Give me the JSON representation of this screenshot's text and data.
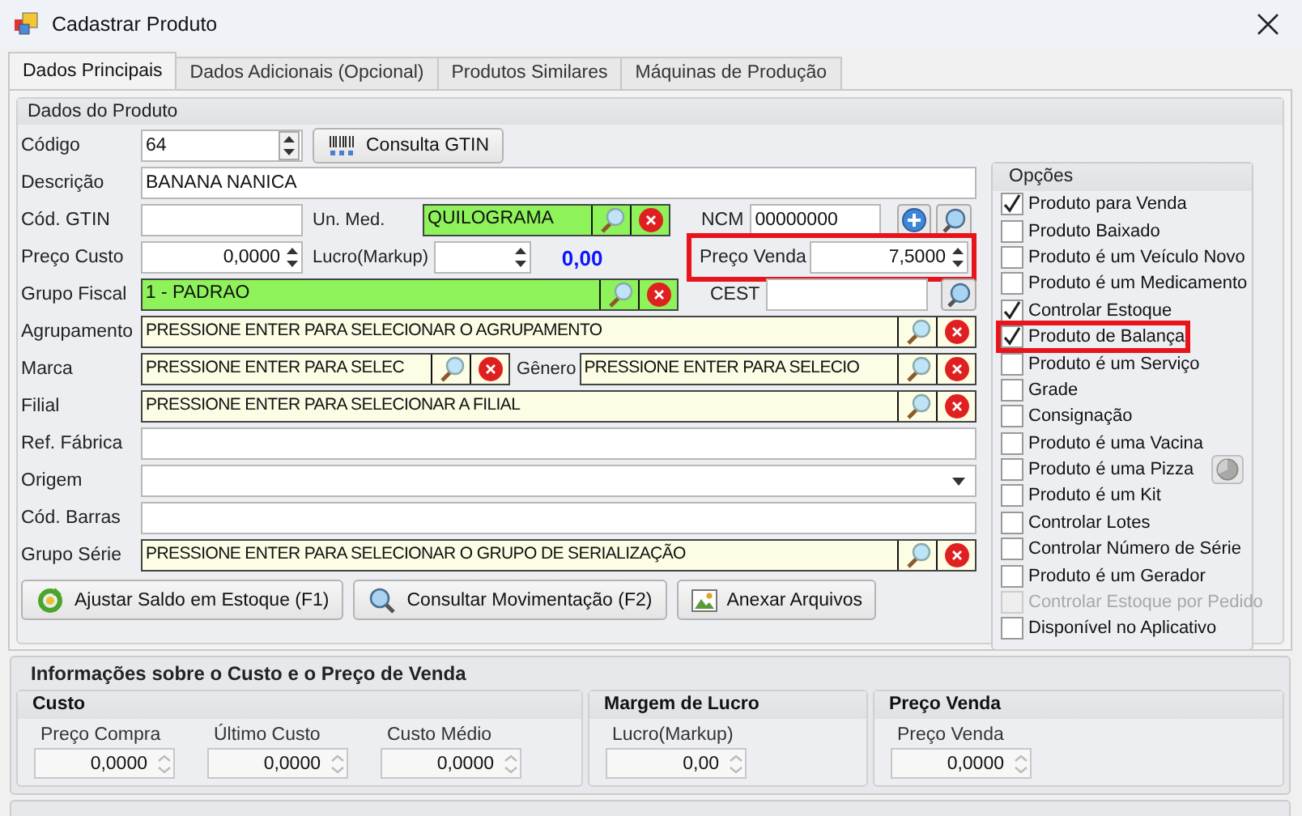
{
  "window": {
    "title": "Cadastrar Produto"
  },
  "tabs": [
    {
      "label": "Dados Principais",
      "selected": true
    },
    {
      "label": "Dados Adicionais (Opcional)",
      "selected": false
    },
    {
      "label": "Produtos Similares",
      "selected": false
    },
    {
      "label": "Máquinas de Produção",
      "selected": false
    }
  ],
  "product_group": {
    "title": "Dados do Produto",
    "rows": [
      {
        "kind": "code",
        "label": "Código",
        "value": "64",
        "button": "Consulta GTIN"
      },
      {
        "kind": "text",
        "label": "Descrição",
        "value": "BANANA NANICA"
      },
      {
        "kind": "gtin",
        "label": "Cód. GTIN",
        "unit_label": "Un. Med.",
        "unit_value": "QUILOGRAMA",
        "ncm_label": "NCM",
        "ncm_value": "00000000"
      },
      {
        "kind": "price",
        "label": "Preço Custo",
        "value": "0,0000",
        "markup_label": "Lucro(Markup)",
        "markup_result": "0,00",
        "sale_label": "Preço Venda",
        "sale_value": "7,5000",
        "sale_highlighted": true
      },
      {
        "kind": "fiscal",
        "label": "Grupo Fiscal",
        "value": "1 - PADRAO",
        "cest_label": "CEST"
      },
      {
        "kind": "lookup",
        "label": "Agrupamento",
        "value": "PRESSIONE ENTER PARA SELECIONAR O AGRUPAMENTO"
      },
      {
        "kind": "split",
        "label": "Marca",
        "value": "PRESSIONE ENTER PARA SELEC",
        "second_label": "Gênero",
        "second_value": "PRESSIONE ENTER PARA SELECIO"
      },
      {
        "kind": "lookup",
        "label": "Filial",
        "value": "PRESSIONE ENTER PARA SELECIONAR A FILIAL"
      },
      {
        "kind": "text",
        "label": "Ref. Fábrica"
      },
      {
        "kind": "combo",
        "label": "Origem"
      },
      {
        "kind": "text",
        "label": "Cód. Barras"
      },
      {
        "kind": "lookup",
        "label": "Grupo Série",
        "value": "PRESSIONE ENTER PARA SELECIONAR O GRUPO DE SERIALIZAÇÃO"
      }
    ],
    "buttons": [
      {
        "kind": "refresh",
        "label": "Ajustar Saldo em Estoque (F1)"
      },
      {
        "kind": "search",
        "label": "Consultar Movimentação (F2)"
      },
      {
        "kind": "image",
        "label": "Anexar Arquivos"
      }
    ]
  },
  "options": {
    "title": "Opções",
    "items": [
      {
        "label": "Produto para Venda",
        "checked": true,
        "disabled": false,
        "highlighted": false
      },
      {
        "label": "Produto Baixado",
        "checked": false,
        "disabled": false,
        "highlighted": false
      },
      {
        "label": "Produto é um Veículo Novo",
        "checked": false,
        "disabled": false,
        "highlighted": false
      },
      {
        "label": "Produto é um Medicamento",
        "checked": false,
        "disabled": false,
        "highlighted": false
      },
      {
        "label": "Controlar Estoque",
        "checked": true,
        "disabled": false,
        "highlighted": false
      },
      {
        "label": "Produto de Balança",
        "checked": true,
        "disabled": false,
        "highlighted": true
      },
      {
        "label": "Produto é um Serviço",
        "checked": false,
        "disabled": false,
        "highlighted": false
      },
      {
        "label": "Grade",
        "checked": false,
        "disabled": false,
        "highlighted": false
      },
      {
        "label": "Consignação",
        "checked": false,
        "disabled": false,
        "highlighted": false
      },
      {
        "label": "Produto é uma Vacina",
        "checked": false,
        "disabled": false,
        "highlighted": false
      },
      {
        "label": "Produto é uma Pizza",
        "checked": false,
        "disabled": false,
        "highlighted": false,
        "kind": "with_button"
      },
      {
        "label": "Produto é um Kit",
        "checked": false,
        "disabled": false,
        "highlighted": false
      },
      {
        "label": "Controlar Lotes",
        "checked": false,
        "disabled": false,
        "highlighted": false
      },
      {
        "label": "Controlar Número de Série",
        "checked": false,
        "disabled": false,
        "highlighted": false
      },
      {
        "label": "Produto é um Gerador",
        "checked": false,
        "disabled": false,
        "highlighted": false
      },
      {
        "label": "Controlar Estoque por Pedido",
        "checked": false,
        "disabled": true,
        "highlighted": false
      },
      {
        "label": "Disponível no Aplicativo",
        "checked": false,
        "disabled": false,
        "highlighted": false
      }
    ]
  },
  "cost_info": {
    "title": "Informações sobre o Custo e o Preço de Venda",
    "groups": [
      {
        "title": "Custo",
        "fields": [
          {
            "label": "Preço Compra",
            "value": "0,0000"
          },
          {
            "label": "Último Custo",
            "value": "0,0000"
          },
          {
            "label": "Custo Médio",
            "value": "0,0000"
          }
        ]
      },
      {
        "title": "Margem de Lucro",
        "fields": [
          {
            "label": "Lucro(Markup)",
            "value": "0,00"
          }
        ]
      },
      {
        "title": "Preço Venda",
        "fields": [
          {
            "label": "Preço Venda",
            "value": "0,0000"
          }
        ]
      }
    ]
  }
}
